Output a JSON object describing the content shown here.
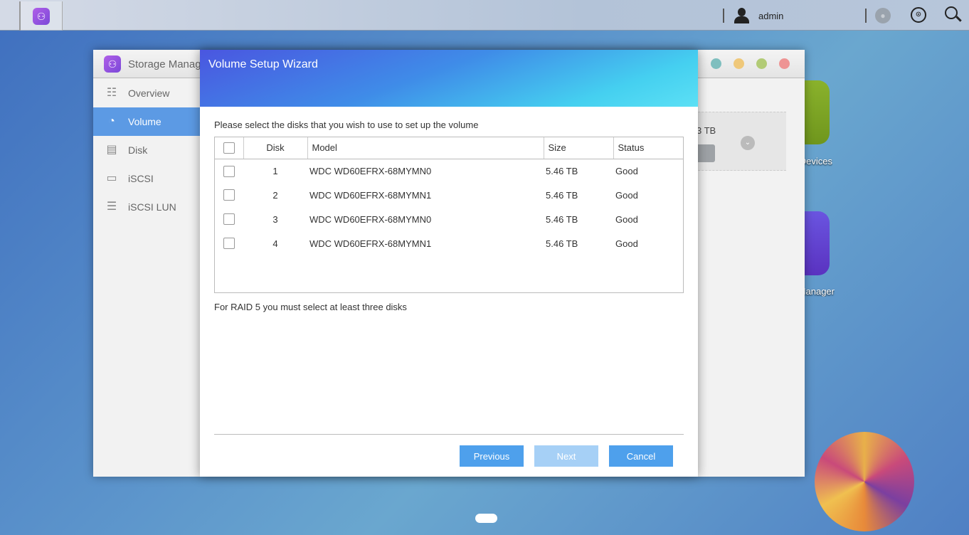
{
  "taskbar": {
    "user": "admin",
    "icons": [
      "storage-manager-icon",
      "user-icon",
      "notification-bell-icon",
      "resource-monitor-gauge-icon",
      "search-icon"
    ]
  },
  "storage_manager": {
    "title": "Storage Manager",
    "nav": [
      {
        "label": "Overview",
        "icon": "list-icon"
      },
      {
        "label": "Volume",
        "icon": "pie-icon",
        "active": true
      },
      {
        "label": "Disk",
        "icon": "disk-icon"
      },
      {
        "label": "iSCSI",
        "icon": "iscsi-icon"
      },
      {
        "label": "iSCSI LUN",
        "icon": "database-icon"
      }
    ],
    "volume_size_partial": "3 TB",
    "window_controls": [
      "#7fbfbf",
      "#efc87a",
      "#b2cb76",
      "#ee9494"
    ]
  },
  "desktop": {
    "icons": [
      {
        "label": "Devices",
        "color": "#7fa324"
      },
      {
        "label": "Manager",
        "color": "#6a46d4"
      }
    ]
  },
  "wizard": {
    "title": "Volume Setup Wizard",
    "instruction": "Please select the disks that you wish to use to set up the volume",
    "columns": [
      "Disk",
      "Model",
      "Size",
      "Status"
    ],
    "rows": [
      {
        "disk": "1",
        "model": "WDC WD60EFRX-68MYMN0",
        "size": "5.46 TB",
        "status": "Good",
        "checked": false
      },
      {
        "disk": "2",
        "model": "WDC WD60EFRX-68MYMN1",
        "size": "5.46 TB",
        "status": "Good",
        "checked": false
      },
      {
        "disk": "3",
        "model": "WDC WD60EFRX-68MYMN0",
        "size": "5.46 TB",
        "status": "Good",
        "checked": false
      },
      {
        "disk": "4",
        "model": "WDC WD60EFRX-68MYMN1",
        "size": "5.46 TB",
        "status": "Good",
        "checked": false
      }
    ],
    "note": "For RAID 5 you must select at least three disks",
    "buttons": {
      "previous": "Previous",
      "next": "Next",
      "cancel": "Cancel"
    }
  }
}
